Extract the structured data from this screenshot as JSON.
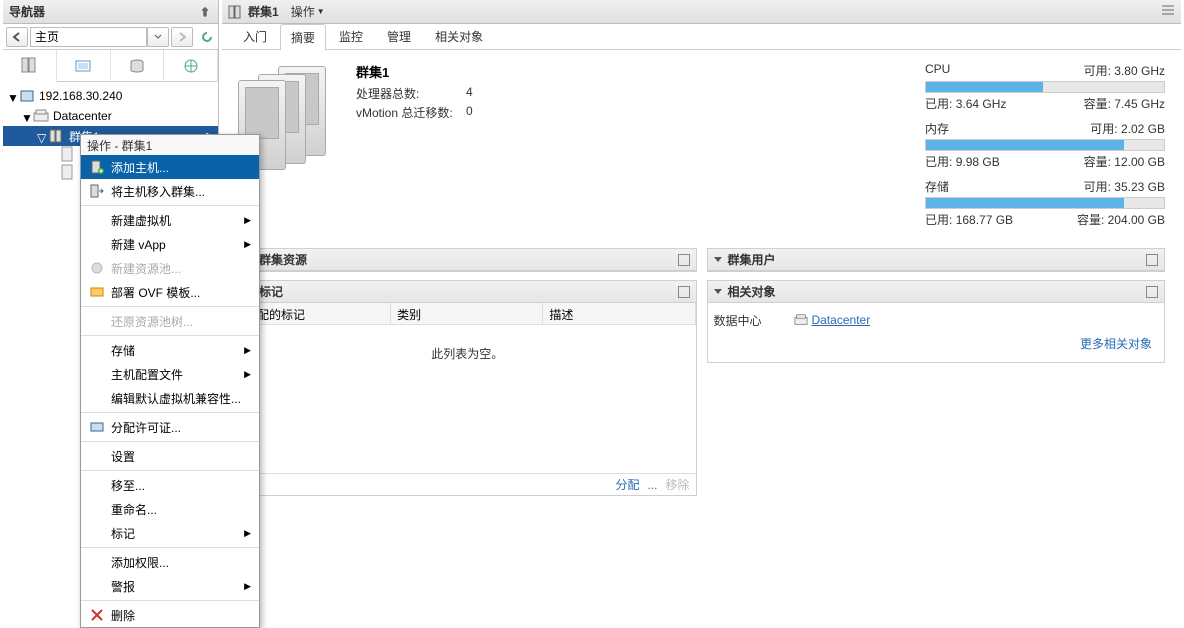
{
  "navigator": {
    "title": "导航器",
    "breadcrumb": "主页",
    "tree": {
      "server_ip": "192.168.30.240",
      "datacenter": "Datacenter",
      "cluster": "群集1"
    }
  },
  "context_menu": {
    "title": "操作 - 群集1",
    "items": {
      "add_host": "添加主机...",
      "move_host": "将主机移入群集...",
      "new_vm": "新建虚拟机",
      "new_vapp": "新建 vApp",
      "new_pool": "新建资源池...",
      "deploy_ovf": "部署 OVF 模板...",
      "restore_tree": "还原资源池树...",
      "storage": "存储",
      "host_profile": "主机配置文件",
      "edit_compat": "编辑默认虚拟机兼容性...",
      "assign_license": "分配许可证...",
      "settings": "设置",
      "move_to": "移至...",
      "rename": "重命名...",
      "tags": "标记",
      "add_perm": "添加权限...",
      "alerts": "警报",
      "delete": "删除"
    }
  },
  "header": {
    "cluster_name": "群集1",
    "action_label": "操作"
  },
  "main_tabs": {
    "getting_started": "入门",
    "summary": "摘要",
    "monitor": "监控",
    "manage": "管理",
    "related": "相关对象"
  },
  "summary": {
    "cluster_title": "群集1",
    "cpu_label": "处理器总数:",
    "cpu_value": "4",
    "vmotion_label": "vMotion 总迁移数:",
    "vmotion_value": "0"
  },
  "meters": {
    "cpu": {
      "label": "CPU",
      "free_label": "可用:",
      "free": "3.80 GHz",
      "used_label": "已用:",
      "used": "3.64 GHz",
      "cap_label": "容量:",
      "cap": "7.45 GHz",
      "pct": 49
    },
    "mem": {
      "label": "内存",
      "free_label": "可用:",
      "free": "2.02 GB",
      "used_label": "已用:",
      "used": "9.98 GB",
      "cap_label": "容量:",
      "cap": "12.00 GB",
      "pct": 83
    },
    "storage": {
      "label": "存储",
      "free_label": "可用:",
      "free": "35.23 GB",
      "used_label": "已用:",
      "used": "168.77 GB",
      "cap_label": "容量:",
      "cap": "204.00 GB",
      "pct": 83
    }
  },
  "panels": {
    "cluster_resources": "群集资源",
    "cluster_users": "群集用户",
    "tags": "标记",
    "related_objects": "相关对象"
  },
  "tags_table": {
    "col1": "分配的标记",
    "col2": "类别",
    "col3": "描述",
    "empty_msg": "此列表为空。",
    "assign": "分配",
    "remove": "移除"
  },
  "related": {
    "datacenter_label": "数据中心",
    "datacenter_link": "Datacenter",
    "more_link": "更多相关对象"
  }
}
